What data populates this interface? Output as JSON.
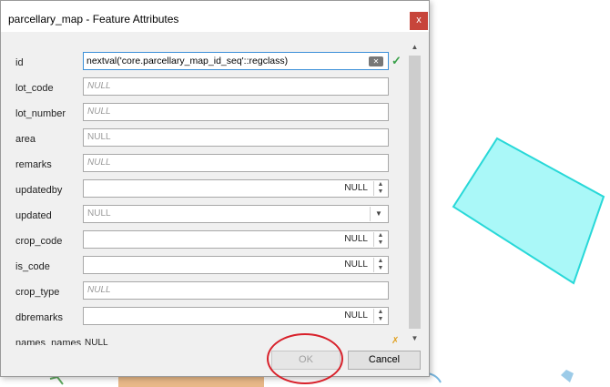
{
  "dialog": {
    "title": "parcellary_map - Feature Attributes",
    "close_label": "x"
  },
  "fields": [
    {
      "label": "id",
      "value": "nextval('core.parcellary_map_id_seq'::regclass)",
      "kind": "text-active"
    },
    {
      "label": "lot_code",
      "value": "NULL",
      "kind": "text-null"
    },
    {
      "label": "lot_number",
      "value": "NULL",
      "kind": "text-null"
    },
    {
      "label": "area",
      "value": "NULL",
      "kind": "text-plain"
    },
    {
      "label": "remarks",
      "value": "NULL",
      "kind": "text-null"
    },
    {
      "label": "updatedby",
      "value": "NULL",
      "kind": "spin"
    },
    {
      "label": "updated",
      "value": "NULL",
      "kind": "dropdown"
    },
    {
      "label": "crop_code",
      "value": "NULL",
      "kind": "spin"
    },
    {
      "label": "is_code",
      "value": "NULL",
      "kind": "spin"
    },
    {
      "label": "crop_type",
      "value": "NULL",
      "kind": "text-null"
    },
    {
      "label": "dbremarks",
      "value": "NULL",
      "kind": "spin"
    },
    {
      "label": "names_names",
      "value": "NULL",
      "kind": "partial"
    }
  ],
  "buttons": {
    "ok_label": "OK",
    "cancel_label": "Cancel"
  },
  "colors": {
    "polygon_fill": "#aaf8f8",
    "polygon_stroke": "#28d8d8",
    "annotation": "#d8202a",
    "valid_check": "#3aa14a"
  },
  "icons": {
    "valid": "check-icon",
    "clear": "clear-icon",
    "invalid": "x-icon"
  }
}
